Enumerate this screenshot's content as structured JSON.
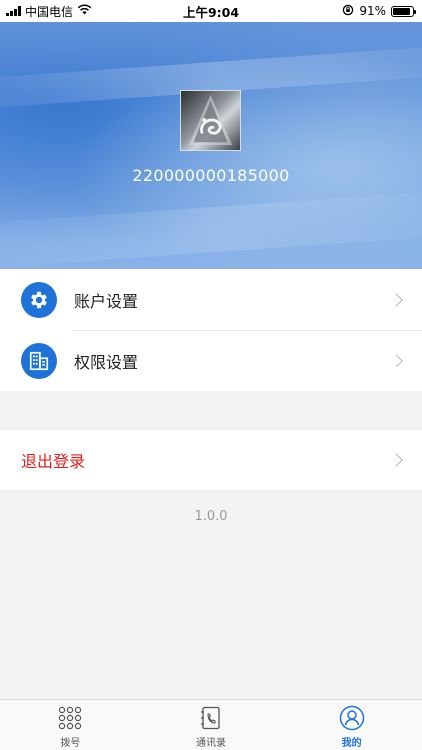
{
  "status_bar": {
    "carrier": "中国电信",
    "time": "上午9:04",
    "battery_percent": "91%",
    "battery_level": 0.91,
    "icons": [
      "signal-icon",
      "wifi-icon",
      "orientation-lock-icon",
      "battery-icon"
    ]
  },
  "profile": {
    "avatar_icon": "company-logo-icon",
    "user_id": "220000000185000"
  },
  "menu": {
    "items": [
      {
        "label": "账户设置",
        "icon": "gear-icon"
      },
      {
        "label": "权限设置",
        "icon": "building-icon"
      }
    ]
  },
  "logout": {
    "label": "退出登录",
    "color": "#e02020"
  },
  "version": "1.0.0",
  "tab_bar": {
    "tabs": [
      {
        "label": "拨号",
        "icon": "dialpad-icon",
        "active": false
      },
      {
        "label": "通讯录",
        "icon": "contacts-book-icon",
        "active": false
      },
      {
        "label": "我的",
        "icon": "user-profile-icon",
        "active": true
      }
    ]
  },
  "colors": {
    "accent": "#1f72d8",
    "danger": "#e02020",
    "background": "#f3f3f3"
  }
}
